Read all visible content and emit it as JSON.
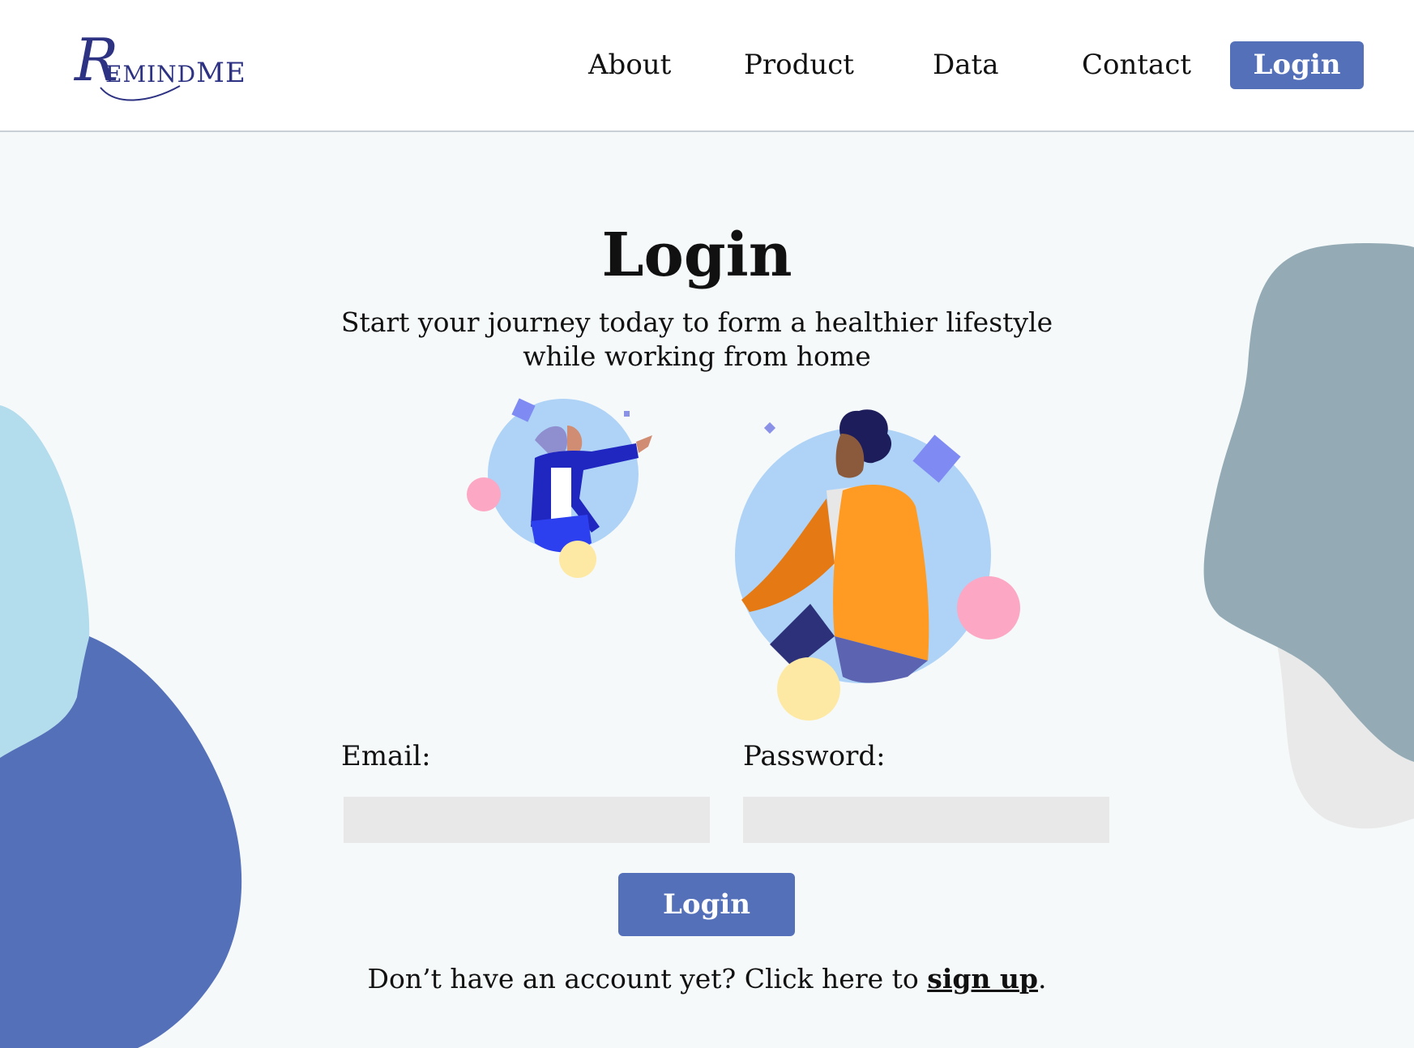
{
  "header": {
    "logo": {
      "initial": "R",
      "rest": "EMIND",
      "rest2": "ME"
    },
    "nav": [
      {
        "label": "About"
      },
      {
        "label": "Product"
      },
      {
        "label": "Data"
      },
      {
        "label": "Contact"
      }
    ],
    "login_label": "Login"
  },
  "main": {
    "title": "Login",
    "subtitle_line1": "Start your journey today to form a healthier lifestyle",
    "subtitle_line2": "while working from home",
    "email_label": "Email:",
    "password_label": "Password:",
    "email_value": "",
    "password_value": "",
    "submit_label": "Login",
    "signup_prefix": "Don’t have an account yet? Click here to ",
    "signup_link": "sign up",
    "signup_suffix": "."
  },
  "colors": {
    "accent": "#5470b9",
    "brand": "#2d3283",
    "input_bg": "#e8e8e8",
    "page_bg": "#f6f9fa"
  }
}
